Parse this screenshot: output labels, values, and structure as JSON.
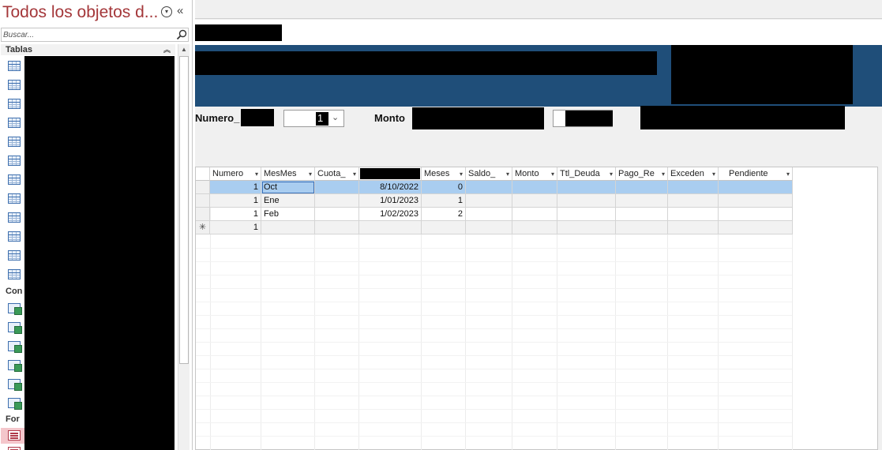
{
  "nav": {
    "title": "Todos los objetos d...",
    "search_placeholder": "Buscar...",
    "groups": {
      "tablas": "Tablas",
      "consultas": "Con",
      "formularios": "For"
    },
    "icons": {
      "menu": "circle-chevron-down-icon",
      "collapse": "double-chevron-left-icon",
      "search": "magnifier-icon",
      "table": "table-icon",
      "query": "query-icon",
      "form": "form-icon"
    }
  },
  "form": {
    "numero_label": "Numero_",
    "numero_value": "1",
    "monto_label": "Monto",
    "header_color": "#1f4e79"
  },
  "datasheet": {
    "columns": [
      "Numero",
      "MesMes",
      "Cuota_",
      "",
      "Meses",
      "Saldo_",
      "Monto",
      "Ttl_Deuda",
      "Pago_Re",
      "Exceden",
      "Pendiente"
    ],
    "rows": [
      [
        "1",
        "Oct",
        "",
        "8/10/2022",
        "0",
        "",
        "",
        "",
        "",
        "",
        ""
      ],
      [
        "1",
        "Ene",
        "",
        "1/01/2023",
        "1",
        "",
        "",
        "",
        "",
        "",
        ""
      ],
      [
        "1",
        "Feb",
        "",
        "1/02/2023",
        "2",
        "",
        "",
        "",
        "",
        "",
        ""
      ]
    ],
    "new_row_marker": "✳",
    "new_row_numero": "1",
    "selection_color": "#a9cdf0"
  }
}
